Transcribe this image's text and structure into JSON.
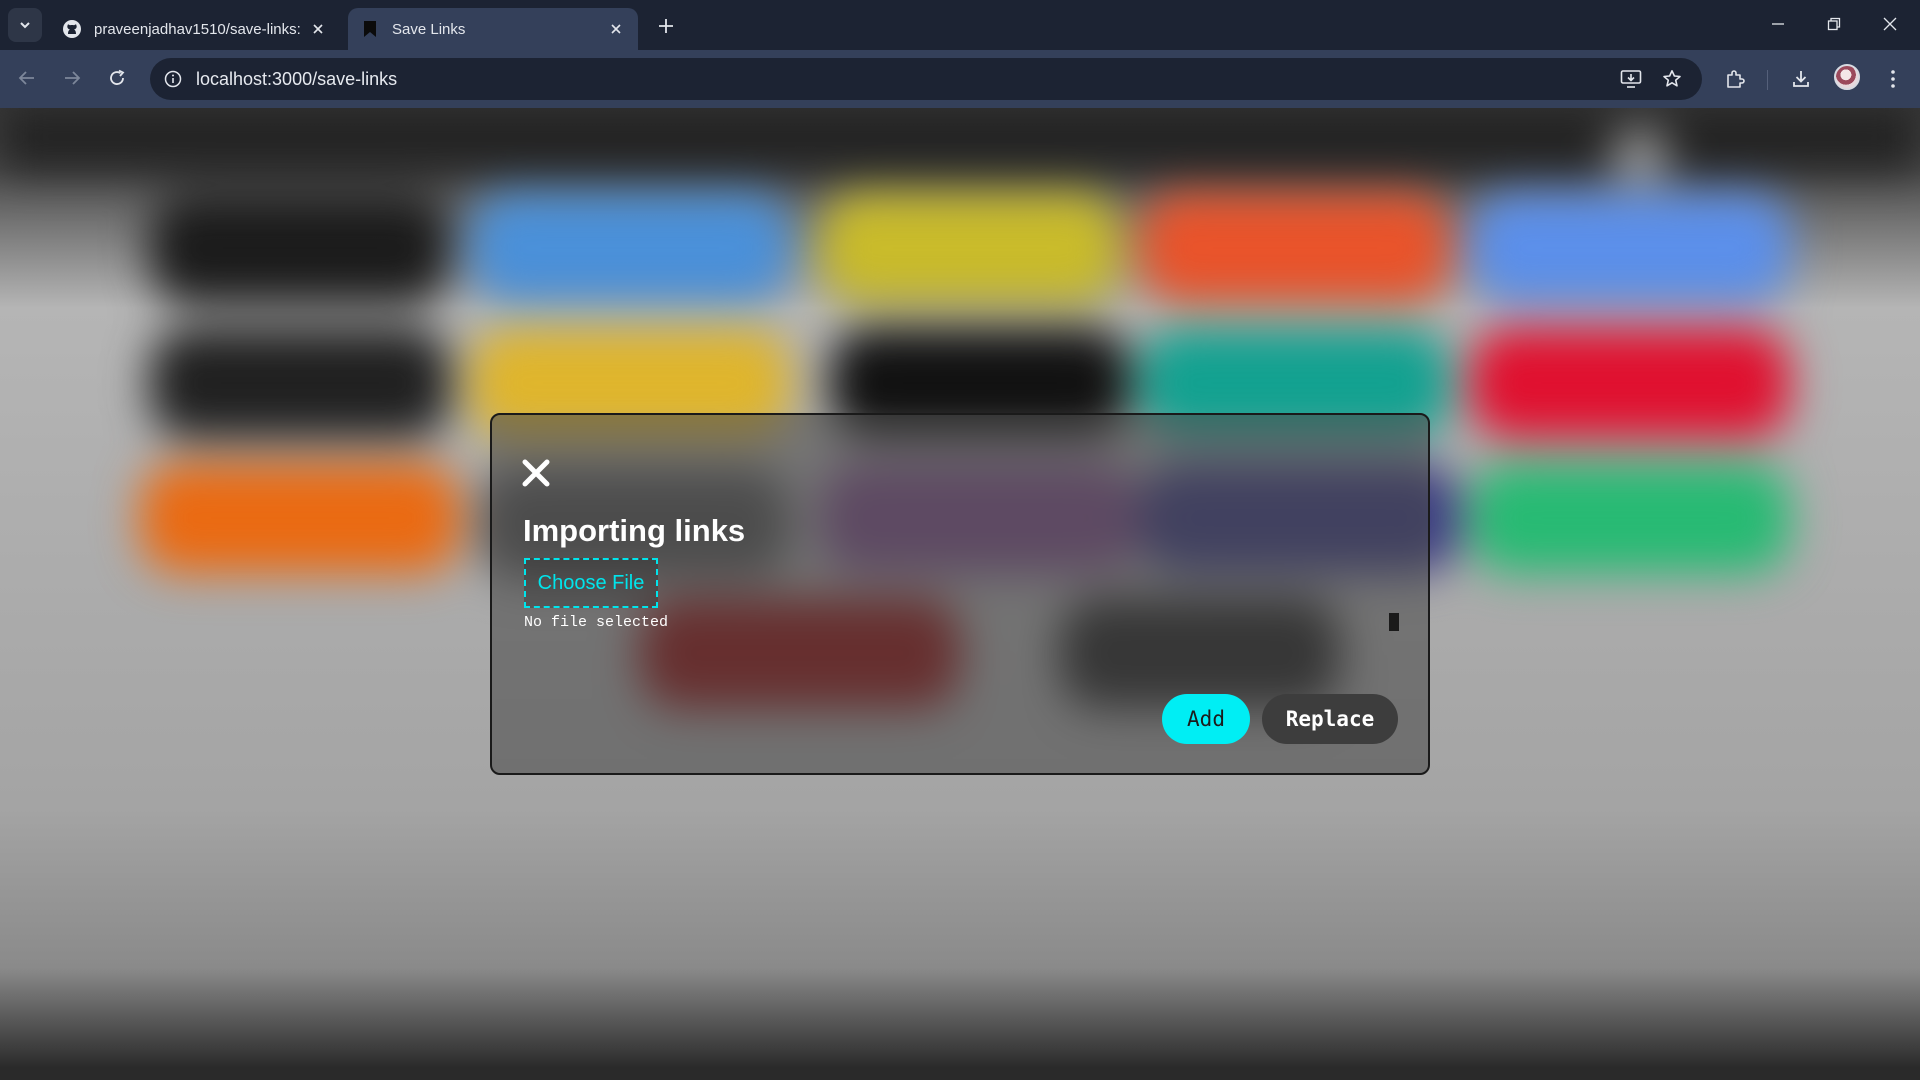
{
  "browser": {
    "tabs": [
      {
        "title": "praveenjadhav1510/save-links:",
        "icon": "github-icon",
        "active": false
      },
      {
        "title": "Save Links",
        "icon": "bookmark-icon",
        "active": true
      }
    ],
    "url": "localhost:3000/save-links"
  },
  "background": {
    "colors": {
      "blue": "#4a90d9",
      "yellow": "#c9bb2a",
      "orange_red": "#e9532a",
      "light_blue": "#5b8fea",
      "gold": "#dfb52c",
      "black": "#111111",
      "teal": "#12a190",
      "red": "#e0102f",
      "orange": "#ea6a12",
      "purple": "#7b4f86",
      "indigo": "#3c3c80",
      "green": "#27ba73",
      "dark_red": "#8f1515",
      "dark": "#252525"
    }
  },
  "modal": {
    "title": "Importing links",
    "choose_file_label": "Choose File",
    "file_status": "No file selected",
    "add_label": "Add",
    "replace_label": "Replace",
    "accent_color": "#00eef4"
  }
}
